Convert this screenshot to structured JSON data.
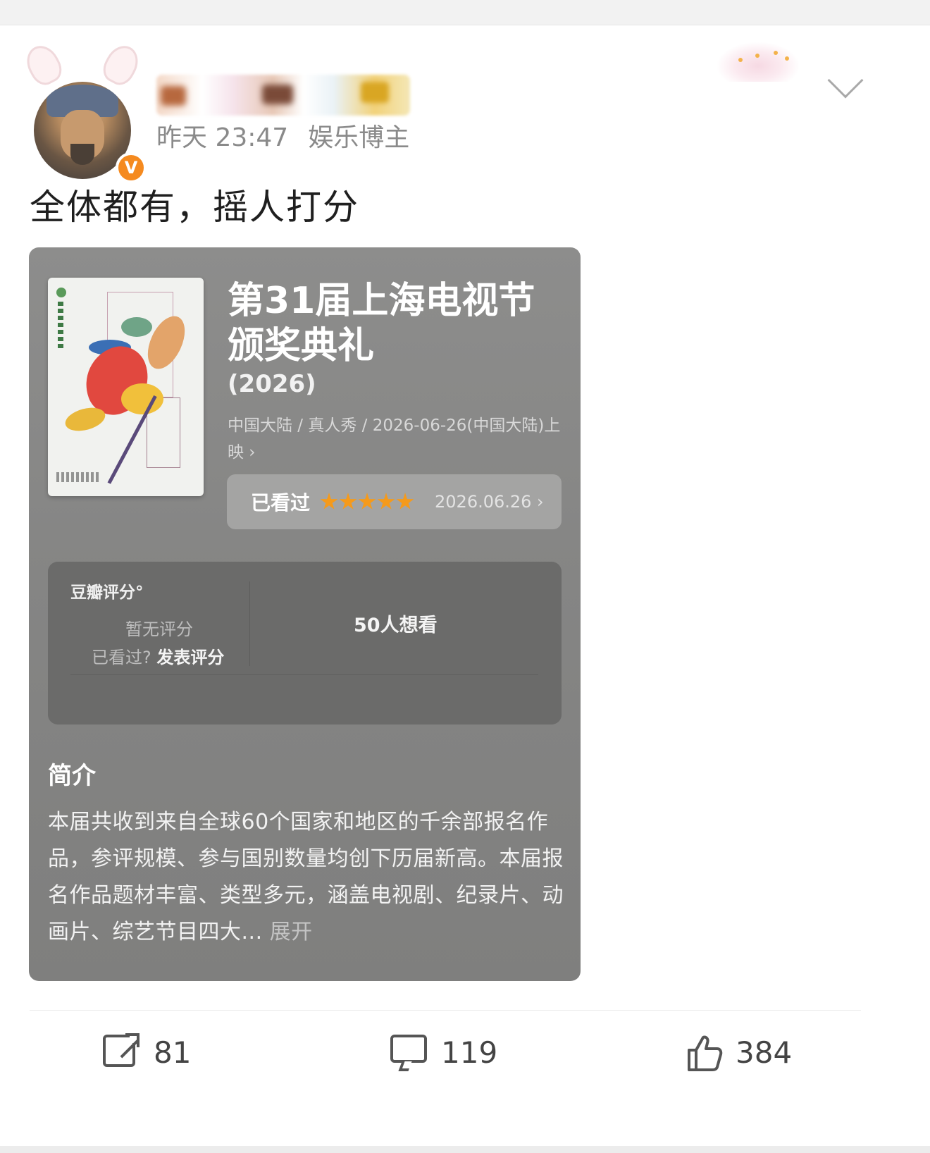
{
  "post": {
    "time": "昨天 23:47",
    "tag": "娱乐博主",
    "text": "全体都有，摇人打分",
    "verified_badge": "V"
  },
  "card": {
    "title": "第31届上海电视节颁奖典礼",
    "year": "(2026)",
    "info": "中国大陆 / 真人秀 / 2026-06-26(中国大陆)上映 ›",
    "watched_label": "已看过",
    "watched_stars": 5,
    "watched_date": "2026.06.26 ›",
    "rating": {
      "header": "豆瓣评分°",
      "none": "暂无评分",
      "seen_prefix": "已看过?",
      "seen_action": "发表评分",
      "want": "50人想看"
    },
    "intro": {
      "header": "简介",
      "body": "本届共收到来自全球60个国家和地区的千余部报名作品，参评规模、参与国别数量均创下历届新高。本届报名作品题材丰富、类型多元，涵盖电视剧、纪录片、动画片、综艺节目四大...",
      "more": "展开"
    }
  },
  "actions": {
    "share": "81",
    "comment": "119",
    "like": "384"
  },
  "colors": {
    "verified": "#f58a1f",
    "star": "#f59a1b",
    "card_bg": "#858584"
  }
}
